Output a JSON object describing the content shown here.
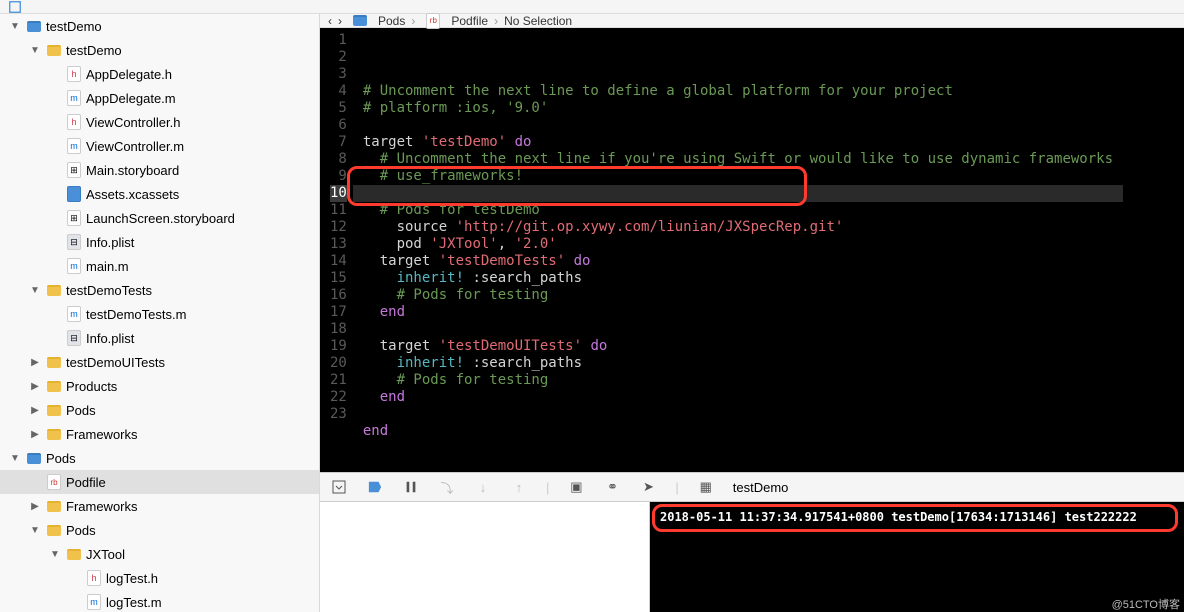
{
  "toolbar_icons": [
    "square",
    "image",
    "grid",
    "database",
    "flask",
    "heart",
    "three-dots",
    "arrow",
    "chat"
  ],
  "breadcrumb": {
    "back": "‹",
    "forward": "›",
    "items": [
      "Pods",
      "Podfile",
      "No Selection"
    ],
    "icons": [
      "folder-blue",
      "file-rb"
    ]
  },
  "sidebar": [
    {
      "name": "testDemo",
      "icon": "folder-blue",
      "ind": 1,
      "open": true
    },
    {
      "name": "testDemo",
      "icon": "folder-yellow",
      "ind": 2,
      "open": true
    },
    {
      "name": "AppDelegate.h",
      "icon": "file-h",
      "ind": 3
    },
    {
      "name": "AppDelegate.m",
      "icon": "file-m",
      "ind": 3
    },
    {
      "name": "ViewController.h",
      "icon": "file-h",
      "ind": 3
    },
    {
      "name": "ViewController.m",
      "icon": "file-m",
      "ind": 3
    },
    {
      "name": "Main.storyboard",
      "icon": "file-sb",
      "ind": 3
    },
    {
      "name": "Assets.xcassets",
      "icon": "file-assets",
      "ind": 3
    },
    {
      "name": "LaunchScreen.storyboard",
      "icon": "file-sb",
      "ind": 3
    },
    {
      "name": "Info.plist",
      "icon": "file-plist",
      "ind": 3
    },
    {
      "name": "main.m",
      "icon": "file-m",
      "ind": 3
    },
    {
      "name": "testDemoTests",
      "icon": "folder-yellow",
      "ind": 2,
      "open": true
    },
    {
      "name": "testDemoTests.m",
      "icon": "file-m",
      "ind": 3
    },
    {
      "name": "Info.plist",
      "icon": "file-plist",
      "ind": 3
    },
    {
      "name": "testDemoUITests",
      "icon": "folder-yellow",
      "ind": 2,
      "closed": true
    },
    {
      "name": "Products",
      "icon": "folder-yellow",
      "ind": 2,
      "closed": true
    },
    {
      "name": "Pods",
      "icon": "folder-yellow",
      "ind": 2,
      "closed": true
    },
    {
      "name": "Frameworks",
      "icon": "folder-yellow",
      "ind": 2,
      "closed": true
    },
    {
      "name": "Pods",
      "icon": "folder-blue",
      "ind": 1,
      "open": true
    },
    {
      "name": "Podfile",
      "icon": "file-rb",
      "ind": 2,
      "selected": true
    },
    {
      "name": "Frameworks",
      "icon": "folder-yellow",
      "ind": 2,
      "closed": true
    },
    {
      "name": "Pods",
      "icon": "folder-yellow",
      "ind": 2,
      "open": true
    },
    {
      "name": "JXTool",
      "icon": "folder-yellow",
      "ind": 3,
      "open": true
    },
    {
      "name": "logTest.h",
      "icon": "file-h",
      "ind": 4
    },
    {
      "name": "logTest.m",
      "icon": "file-m",
      "ind": 4
    }
  ],
  "code_lines": [
    [
      {
        "t": "# Uncomment the next line to define a global platform for your project",
        "c": "cm-comment"
      }
    ],
    [
      {
        "t": "# platform :ios, '9.0'",
        "c": "cm-comment"
      }
    ],
    [],
    [
      {
        "t": "target ",
        "c": "cm-plain"
      },
      {
        "t": "'testDemo'",
        "c": "cm-string"
      },
      {
        "t": " do",
        "c": "cm-keyword"
      }
    ],
    [
      {
        "t": "  # Uncomment the next line if you're using Swift or would like to use dynamic frameworks",
        "c": "cm-comment"
      }
    ],
    [
      {
        "t": "  # use_frameworks!",
        "c": "cm-comment"
      }
    ],
    [],
    [
      {
        "t": "  # Pods for testDemo",
        "c": "cm-comment"
      }
    ],
    [
      {
        "t": "    source ",
        "c": "cm-plain"
      },
      {
        "t": "'http://git.op.xywy.com/liunian/JXSpecRep.git'",
        "c": "cm-string"
      }
    ],
    [
      {
        "t": "    pod ",
        "c": "cm-plain"
      },
      {
        "t": "'JXTool'",
        "c": "cm-string"
      },
      {
        "t": ", ",
        "c": "cm-plain"
      },
      {
        "t": "'2.0'",
        "c": "cm-string"
      }
    ],
    [
      {
        "t": "  target ",
        "c": "cm-plain"
      },
      {
        "t": "'testDemoTests'",
        "c": "cm-string"
      },
      {
        "t": " do",
        "c": "cm-keyword"
      }
    ],
    [
      {
        "t": "    inherit! ",
        "c": "cm-ident"
      },
      {
        "t": ":search_paths",
        "c": "cm-plain"
      }
    ],
    [
      {
        "t": "    # Pods for testing",
        "c": "cm-comment"
      }
    ],
    [
      {
        "t": "  end",
        "c": "cm-keyword"
      }
    ],
    [],
    [
      {
        "t": "  target ",
        "c": "cm-plain"
      },
      {
        "t": "'testDemoUITests'",
        "c": "cm-string"
      },
      {
        "t": " do",
        "c": "cm-keyword"
      }
    ],
    [
      {
        "t": "    inherit! ",
        "c": "cm-ident"
      },
      {
        "t": ":search_paths",
        "c": "cm-plain"
      }
    ],
    [
      {
        "t": "    # Pods for testing",
        "c": "cm-comment"
      }
    ],
    [
      {
        "t": "  end",
        "c": "cm-keyword"
      }
    ],
    [],
    [
      {
        "t": "end",
        "c": "cm-keyword"
      }
    ],
    [],
    []
  ],
  "current_line": 10,
  "debug_target": "testDemo",
  "console_output": "2018-05-11 11:37:34.917541+0800 testDemo[17634:1713146] test222222",
  "watermark": "@51CTO博客"
}
